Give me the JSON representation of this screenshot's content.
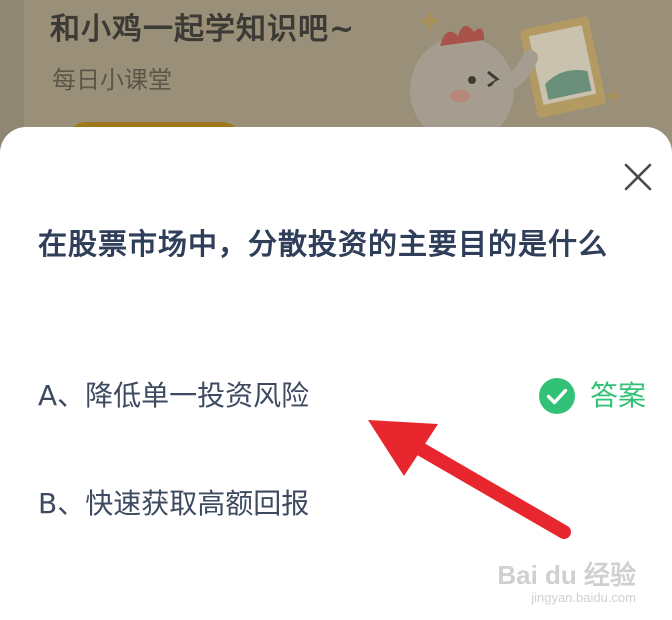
{
  "banner": {
    "title": "和小鸡一起学知识吧~",
    "subtitle": "每日小课堂"
  },
  "dialog": {
    "question": "在股票市场中，分散投资的主要目的是什么",
    "options": [
      {
        "text": "A、降低单一投资风险"
      },
      {
        "text": "B、快速获取高额回报"
      }
    ],
    "answer_label": "答案",
    "close_icon": "close-icon",
    "answer_icon": "check-circle-icon"
  },
  "annotation": {
    "arrow_icon": "red-arrow-icon",
    "arrow_color": "#e8262d"
  },
  "watermark": {
    "logo": "Bai du 经验",
    "url": "jingyan.baidu.com"
  },
  "colors": {
    "question_text": "#2f3e59",
    "option_text": "#3e4a60",
    "answer_green": "#31c277"
  }
}
